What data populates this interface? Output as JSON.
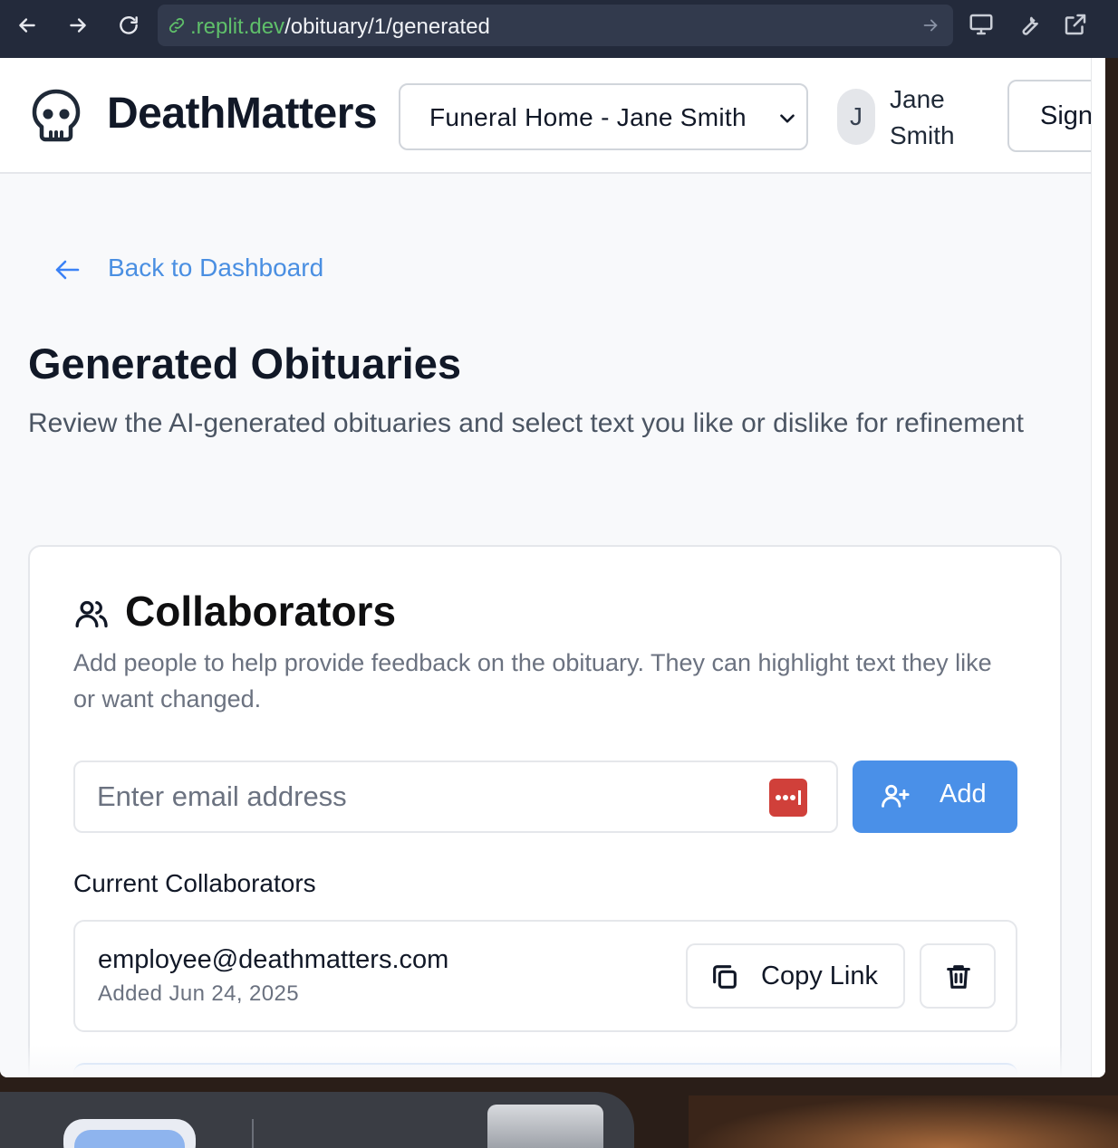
{
  "browser": {
    "url_prefix": ".replit.dev",
    "url_path": "/obituary/1/generated"
  },
  "header": {
    "brand": "DeathMatters",
    "org_select": "Funeral Home - Jane Smith",
    "avatar_initial": "J",
    "user_name": "Jane Smith",
    "sign_button": "Sign"
  },
  "main": {
    "back_link": "Back to Dashboard",
    "title": "Generated Obituaries",
    "subtitle": "Review the AI-generated obituaries and select text you like or dislike for refinement"
  },
  "collaborators": {
    "title": "Collaborators",
    "description": "Add people to help provide feedback on the obituary. They can highlight text they like or want changed.",
    "email_placeholder": "Enter email address",
    "add_button": "Add",
    "current_label": "Current Collaborators",
    "items": [
      {
        "email": "employee@deathmatters.com",
        "added": "Added Jun 24, 2025",
        "copy_label": "Copy Link"
      }
    ]
  },
  "colors": {
    "accent": "#4a90e8",
    "link": "#4a8fe2",
    "password_badge": "#d0403a"
  }
}
